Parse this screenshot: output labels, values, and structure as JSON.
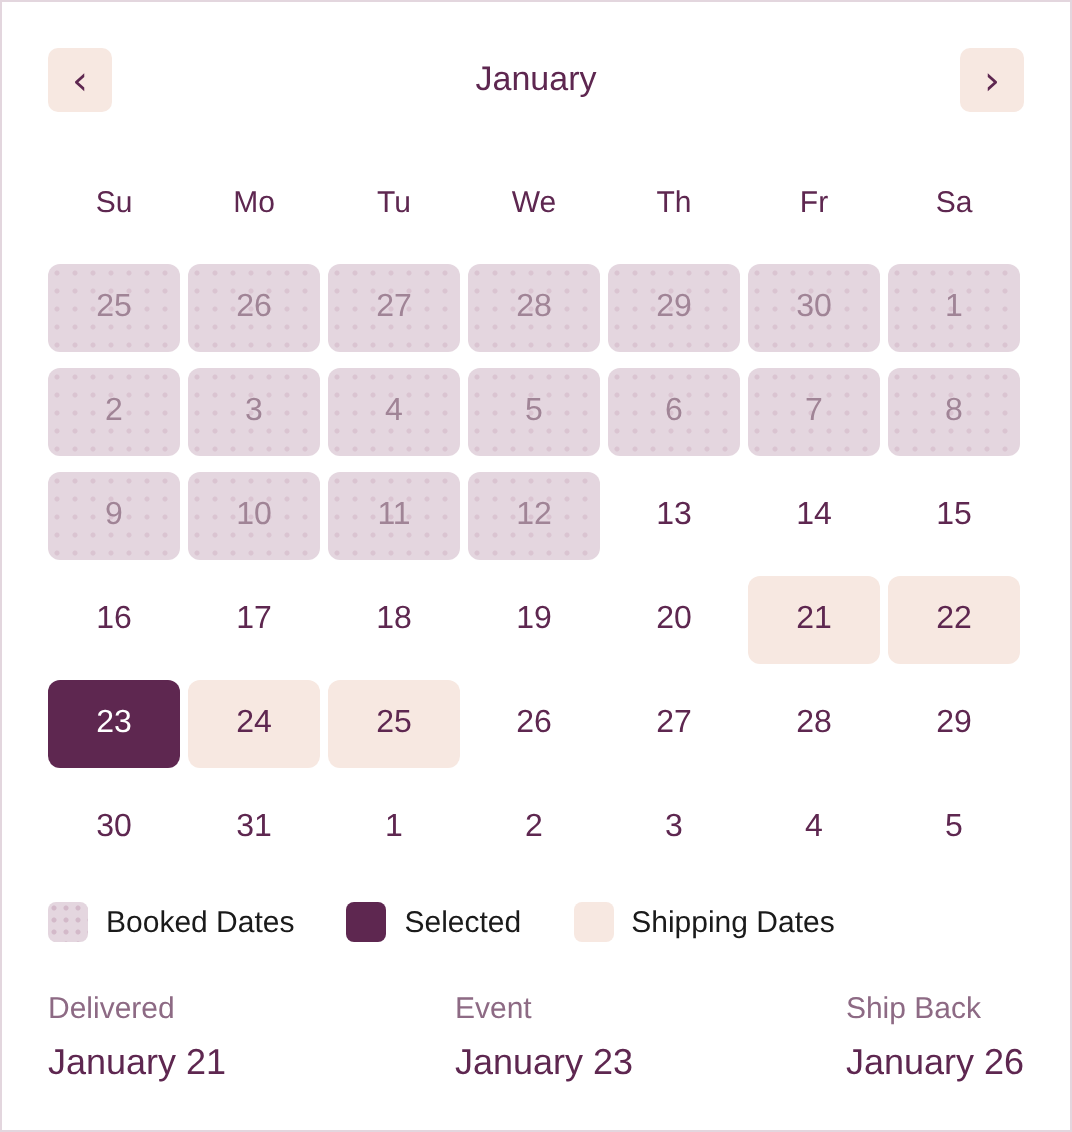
{
  "header": {
    "prev": "‹",
    "title": "January",
    "next": "›"
  },
  "weekdays": [
    "Su",
    "Mo",
    "Tu",
    "We",
    "Th",
    "Fr",
    "Sa"
  ],
  "days": [
    {
      "label": "25",
      "kind": "booked",
      "selected": false
    },
    {
      "label": "26",
      "kind": "booked",
      "selected": false
    },
    {
      "label": "27",
      "kind": "booked",
      "selected": false
    },
    {
      "label": "28",
      "kind": "booked",
      "selected": false
    },
    {
      "label": "29",
      "kind": "booked",
      "selected": false
    },
    {
      "label": "30",
      "kind": "booked",
      "selected": false
    },
    {
      "label": "1",
      "kind": "booked",
      "selected": false
    },
    {
      "label": "2",
      "kind": "booked",
      "selected": false
    },
    {
      "label": "3",
      "kind": "booked",
      "selected": false
    },
    {
      "label": "4",
      "kind": "booked",
      "selected": false
    },
    {
      "label": "5",
      "kind": "booked",
      "selected": false
    },
    {
      "label": "6",
      "kind": "booked",
      "selected": false
    },
    {
      "label": "7",
      "kind": "booked",
      "selected": false
    },
    {
      "label": "8",
      "kind": "booked",
      "selected": false
    },
    {
      "label": "9",
      "kind": "booked",
      "selected": false
    },
    {
      "label": "10",
      "kind": "booked",
      "selected": false
    },
    {
      "label": "11",
      "kind": "booked",
      "selected": false
    },
    {
      "label": "12",
      "kind": "booked",
      "selected": false
    },
    {
      "label": "13",
      "kind": "plain",
      "selected": false
    },
    {
      "label": "14",
      "kind": "plain",
      "selected": false
    },
    {
      "label": "15",
      "kind": "plain",
      "selected": false
    },
    {
      "label": "16",
      "kind": "plain",
      "selected": false
    },
    {
      "label": "17",
      "kind": "plain",
      "selected": false
    },
    {
      "label": "18",
      "kind": "plain",
      "selected": false
    },
    {
      "label": "19",
      "kind": "plain",
      "selected": false
    },
    {
      "label": "20",
      "kind": "plain",
      "selected": false
    },
    {
      "label": "21",
      "kind": "shipping",
      "selected": false
    },
    {
      "label": "22",
      "kind": "shipping",
      "selected": false
    },
    {
      "label": "23",
      "kind": "plain",
      "selected": true
    },
    {
      "label": "24",
      "kind": "shipping",
      "selected": false
    },
    {
      "label": "25",
      "kind": "shipping",
      "selected": false
    },
    {
      "label": "26",
      "kind": "plain",
      "selected": false
    },
    {
      "label": "27",
      "kind": "plain",
      "selected": false
    },
    {
      "label": "28",
      "kind": "plain",
      "selected": false
    },
    {
      "label": "29",
      "kind": "plain",
      "selected": false
    },
    {
      "label": "30",
      "kind": "plain",
      "selected": false
    },
    {
      "label": "31",
      "kind": "plain",
      "selected": false
    },
    {
      "label": "1",
      "kind": "plain",
      "selected": false
    },
    {
      "label": "2",
      "kind": "plain",
      "selected": false
    },
    {
      "label": "3",
      "kind": "plain",
      "selected": false
    },
    {
      "label": "4",
      "kind": "plain",
      "selected": false
    },
    {
      "label": "5",
      "kind": "plain",
      "selected": false
    }
  ],
  "legend": [
    {
      "label": "Booked Dates",
      "kind": "booked"
    },
    {
      "label": "Selected",
      "kind": "selected"
    },
    {
      "label": "Shipping Dates",
      "kind": "shipping"
    }
  ],
  "summary": [
    {
      "label": "Delivered",
      "value": "January 21"
    },
    {
      "label": "Event",
      "value": "January 23"
    },
    {
      "label": "Ship Back",
      "value": "January 26"
    }
  ]
}
